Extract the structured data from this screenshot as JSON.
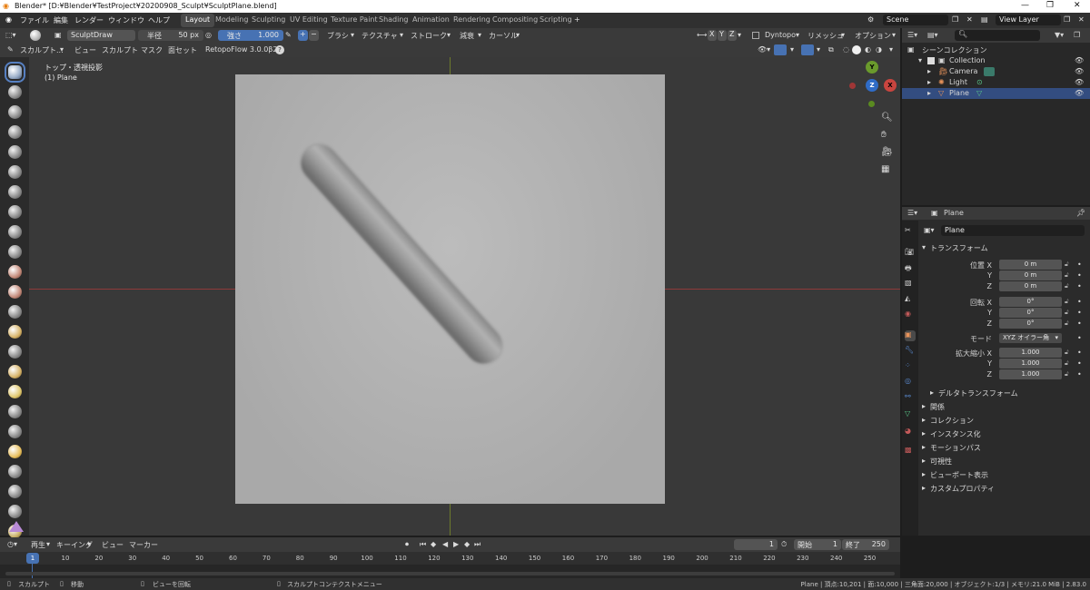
{
  "title": "Blender* [D:¥Blender¥TestProject¥20200908_Sculpt¥SculptPlane.blend]",
  "menu": [
    "ファイル",
    "編集",
    "レンダー",
    "ウィンドウ",
    "ヘルプ"
  ],
  "workspaces": [
    "Layout",
    "Modeling",
    "Sculpting",
    "UV Editing",
    "Texture Paint",
    "Shading",
    "Animation",
    "Rendering",
    "Compositing",
    "Scripting"
  ],
  "scene": "Scene",
  "view_layer": "View Layer",
  "brush": "SculptDraw",
  "radius": {
    "label": "半径",
    "value": "50 px"
  },
  "strength": {
    "label": "強さ",
    "value": "1.000"
  },
  "tool_menus": [
    "ブラシ",
    "テクスチャ",
    "ストローク",
    "減衰",
    "カーソル"
  ],
  "axes": [
    "X",
    "Y",
    "Z"
  ],
  "dyntopo": "Dyntopo",
  "remesh": "リメッシュ",
  "options": "オプション",
  "mode_menu": [
    "スカルプト...",
    "ビュー",
    "スカルプト",
    "マスク",
    "面セット"
  ],
  "retopo": "RetopoFlow 3.0.0β2",
  "view_label": "トップ・透視投影",
  "object_label": "(1) Plane",
  "gizmo": {
    "y": "Y",
    "z": "Z",
    "x": "X"
  },
  "outliner": {
    "root": "シーンコレクション",
    "items": [
      {
        "label": "Collection"
      },
      {
        "label": "Camera"
      },
      {
        "label": "Light"
      },
      {
        "label": "Plane"
      }
    ]
  },
  "props": {
    "object": "Plane",
    "datablock": "Plane",
    "transform": "トランスフォーム",
    "loc_label": "位置 X",
    "rot_label": "回転 X",
    "scale_label": "拡大縮小 X",
    "y": "Y",
    "z": "Z",
    "loc": [
      "0 m",
      "0 m",
      "0 m"
    ],
    "rot": [
      "0°",
      "0°",
      "0°"
    ],
    "mode_label": "モード",
    "mode_value": "XYZ オイラー角",
    "scale": [
      "1.000",
      "1.000",
      "1.000"
    ],
    "delta": "デルタトランスフォーム",
    "sections": [
      "関係",
      "コレクション",
      "インスタンス化",
      "モーションパス",
      "可視性",
      "ビューポート表示",
      "カスタムプロパティ"
    ]
  },
  "timeline": {
    "menus": [
      "再生",
      "キーイング",
      "ビュー",
      "マーカー"
    ],
    "current": "1",
    "start_label": "開始",
    "start": "1",
    "end_label": "終了",
    "end": "250",
    "ticks": [
      "1",
      "10",
      "20",
      "30",
      "40",
      "50",
      "60",
      "70",
      "80",
      "90",
      "100",
      "110",
      "120",
      "130",
      "140",
      "150",
      "160",
      "170",
      "180",
      "190",
      "200",
      "210",
      "220",
      "230",
      "240",
      "250"
    ]
  },
  "status": {
    "left": [
      "スカルプト",
      "移動",
      "ビューを回転",
      "スカルプトコンテクストメニュー"
    ],
    "right": "Plane | 頂点:10,201 | 面:10,000 | 三角面:20,000 | オブジェクト:1/3 | メモリ:21.0 MiB | 2.83.0"
  },
  "colors": {
    "accent": "#4772b3",
    "x_axis": "#c9453f",
    "y_axis": "#6a9a2c",
    "z_axis": "#2f6cc7"
  }
}
